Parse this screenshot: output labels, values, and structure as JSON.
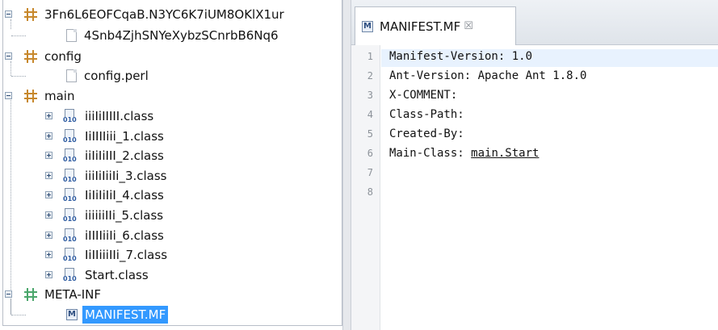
{
  "tree": {
    "items": [
      {
        "label": "3Fn6L6EOFCqaB.N3YC6K7iUM8OKlX1ur",
        "type": "package",
        "level": 0,
        "toggle": "minus"
      },
      {
        "label": "4Snb4ZjhSNYeXybzSCnrbB6Nq6",
        "type": "file",
        "level": 1
      },
      {
        "label": "config",
        "type": "package",
        "level": 0,
        "toggle": "minus"
      },
      {
        "label": "config.perl",
        "type": "file",
        "level": 1
      },
      {
        "label": "main",
        "type": "package",
        "level": 0,
        "toggle": "minus"
      },
      {
        "label": "iiiIiIIIII.class",
        "type": "class",
        "level": 1,
        "toggle": "plus"
      },
      {
        "label": "IiIIIIiii_1.class",
        "type": "class",
        "level": 1,
        "toggle": "plus"
      },
      {
        "label": "iiIiIiIII_2.class",
        "type": "class",
        "level": 1,
        "toggle": "plus"
      },
      {
        "label": "iiiIiIiiIi_3.class",
        "type": "class",
        "level": 1,
        "toggle": "plus"
      },
      {
        "label": "IiIiIiIiI_4.class",
        "type": "class",
        "level": 1,
        "toggle": "plus"
      },
      {
        "label": "iiiiiiIIi_5.class",
        "type": "class",
        "level": 1,
        "toggle": "plus"
      },
      {
        "label": "iIIIIiiIi_6.class",
        "type": "class",
        "level": 1,
        "toggle": "plus"
      },
      {
        "label": "IiIIiiiIIi_7.class",
        "type": "class",
        "level": 1,
        "toggle": "plus"
      },
      {
        "label": "Start.class",
        "type": "class",
        "level": 1,
        "toggle": "plus"
      },
      {
        "label": "META-INF",
        "type": "package-green",
        "level": 0,
        "toggle": "minus"
      },
      {
        "label": "MANIFEST.MF",
        "type": "manifest",
        "level": 1,
        "selected": true
      }
    ]
  },
  "editor": {
    "tab_title": "MANIFEST.MF",
    "tab_icon_letter": "M",
    "close_glyph": "☒",
    "line_numbers": [
      "1",
      "2",
      "3",
      "4",
      "5",
      "6",
      "7",
      "8"
    ],
    "lines": [
      {
        "text": "Manifest-Version: 1.0"
      },
      {
        "text": "Ant-Version: Apache Ant 1.8.0"
      },
      {
        "text": "X-COMMENT:"
      },
      {
        "text": "Class-Path:"
      },
      {
        "text": "Created-By:"
      },
      {
        "text": "Main-Class: ",
        "link": "main.Start"
      },
      {
        "text": ""
      },
      {
        "text": ""
      }
    ]
  },
  "colors": {
    "selection": "#3399ff",
    "package_icon": "#c7882c",
    "meta_inf_icon": "#4aa66b"
  }
}
